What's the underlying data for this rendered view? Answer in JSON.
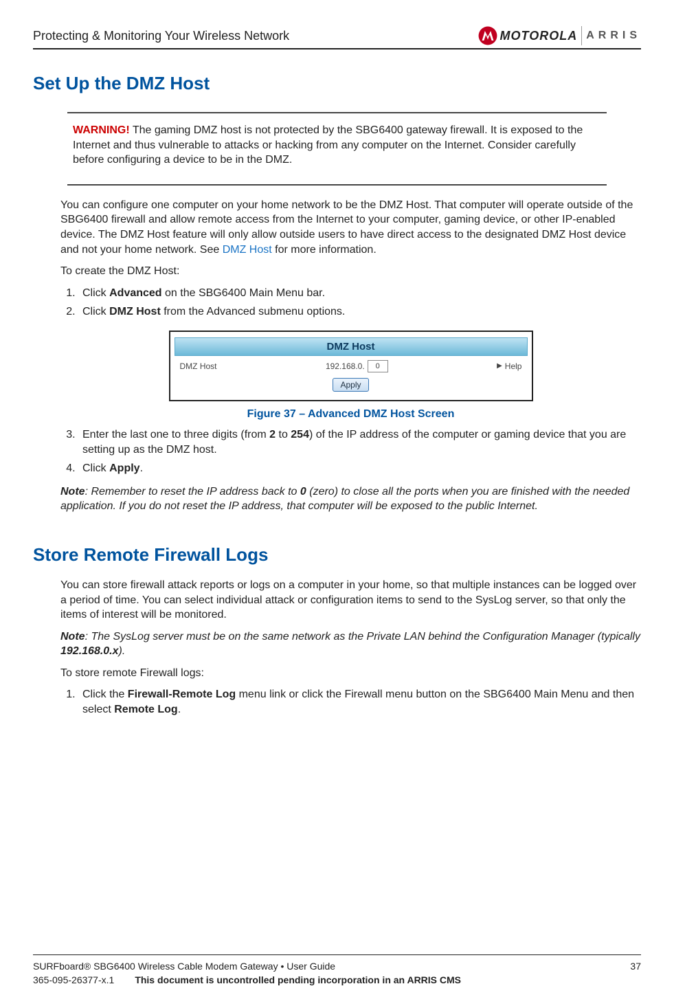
{
  "header": {
    "title": "Protecting & Monitoring Your Wireless Network",
    "logo_motorola": "MOTOROLA",
    "logo_arris": "ARRIS"
  },
  "section1": {
    "heading": "Set Up the DMZ Host",
    "warning_label": "WARNING!",
    "warning_text": " The gaming DMZ host is not protected by the SBG6400 gateway firewall. It is exposed to the Internet and thus vulnerable to attacks or hacking from any computer on the Internet. Consider carefully before configuring a device to be in the DMZ.",
    "intro_pre": "You can configure one computer on your home network to be the DMZ Host. That computer will operate outside of the SBG6400 firewall and allow remote access from the Internet to your computer, gaming device, or other IP-enabled device. The DMZ Host feature will only allow outside users to have direct access to the designated DMZ Host device and not your home network. See ",
    "intro_link": "DMZ Host",
    "intro_post": " for more information.",
    "create_intro": "To create the DMZ Host:",
    "step1_pre": "Click ",
    "step1_bold": "Advanced",
    "step1_post": " on the SBG6400 Main Menu bar.",
    "step2_pre": "Click ",
    "step2_bold": "DMZ Host",
    "step2_post": " from the Advanced submenu options.",
    "screenshot": {
      "title": "DMZ Host",
      "row_label": "DMZ Host",
      "ip_prefix": "192.168.0.",
      "ip_value": "0",
      "help": "Help",
      "apply": "Apply"
    },
    "figure_caption": "Figure 37 – Advanced DMZ Host Screen",
    "step3_pre": "Enter the last one to three digits (from ",
    "step3_b1": "2",
    "step3_mid": " to ",
    "step3_b2": "254",
    "step3_post": ") of the IP address of the computer or gaming device that you are setting up as the DMZ host.",
    "step4_pre": "Click ",
    "step4_bold": "Apply",
    "step4_post": ".",
    "note_label": "Note",
    "note_text_pre": ": Remember to reset the IP address back to ",
    "note_bold": "0",
    "note_text_post": " (zero) to close all the ports when you are finished with the needed application. If you do not reset the IP address, that computer will be exposed to the public Internet."
  },
  "section2": {
    "heading": "Store Remote Firewall Logs",
    "intro": "You can store firewall attack reports or logs on a computer in your home, so that multiple instances can be logged over a period of time. You can select individual attack or configuration items to send to the SysLog server, so that only the items of interest will be monitored.",
    "note_label": "Note",
    "note_pre": ": The SysLog server must be on the same network as the Private LAN behind the Configuration Manager (typically ",
    "note_bold": "192.168.0.x",
    "note_post": ").",
    "store_intro": "To store remote Firewall logs:",
    "step1_pre": "Click the ",
    "step1_b1": "Firewall-Remote Log",
    "step1_mid": " menu link or click the Firewall menu button on the SBG6400 Main Menu and then select ",
    "step1_b2": "Remote Log",
    "step1_post": "."
  },
  "footer": {
    "product": "SURFboard® SBG6400 Wireless Cable Modem Gateway • User Guide",
    "page": "37",
    "doc_id": "365-095-26377-x.1",
    "status": "This document is uncontrolled pending incorporation in an ARRIS CMS"
  }
}
